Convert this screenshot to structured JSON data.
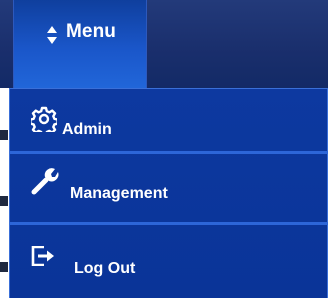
{
  "navbar": {
    "toggle_label": "Menu",
    "toggle_icon": "sort-arrows-icon"
  },
  "menu": {
    "items": [
      {
        "label": "Admin",
        "icon": "gear-icon"
      },
      {
        "label": "Management",
        "icon": "wrench-icon"
      },
      {
        "label": "Log Out",
        "icon": "sign-out-icon"
      }
    ]
  },
  "colors": {
    "navbar_background": "#1a2f6d",
    "toggle_background": "#1a56c9",
    "dropdown_background": "#0b369c",
    "divider": "#2d66d8",
    "text": "#ffffff"
  }
}
